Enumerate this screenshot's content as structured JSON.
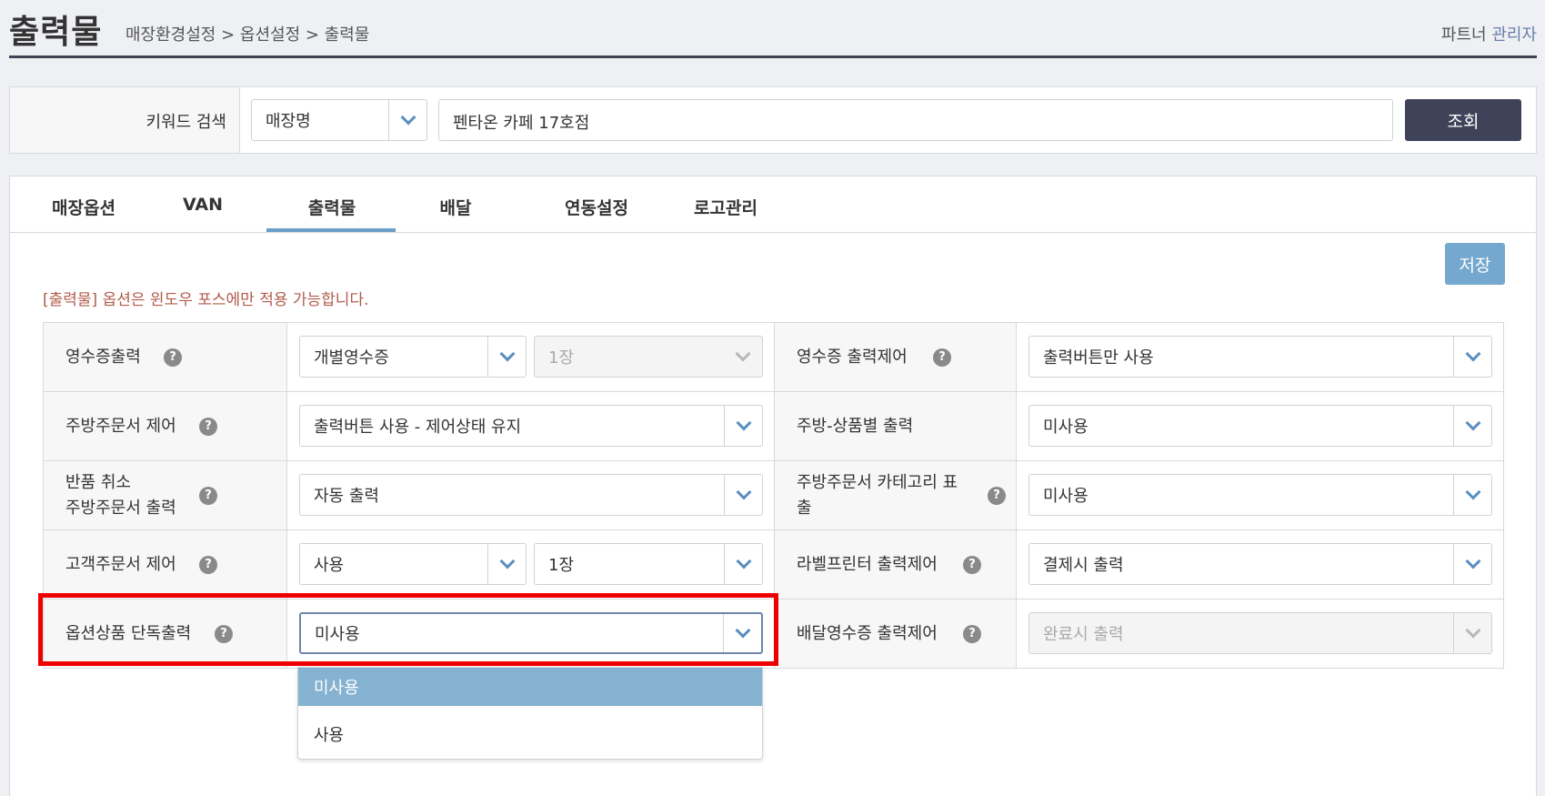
{
  "header": {
    "title": "출력물",
    "breadcrumb": "매장환경설정 > 옵션설정 > 출력물",
    "role_prefix": "파트너",
    "role_accent": "관리자"
  },
  "search": {
    "label": "키워드 검색",
    "field_select": "매장명",
    "keyword_value": "펜타온 카페 17호점",
    "button": "조회"
  },
  "tabs": [
    {
      "label": "매장옵션"
    },
    {
      "label": "VAN"
    },
    {
      "label": "출력물",
      "active": true
    },
    {
      "label": "배달"
    },
    {
      "label": "연동설정"
    },
    {
      "label": "로고관리"
    }
  ],
  "save_button": "저장",
  "notice": "[출력물] 옵션은 윈도우 포스에만 적용 가능합니다.",
  "help_glyph": "?",
  "options": {
    "r0": {
      "left_label": "영수증출력",
      "left_select_1": "개별영수증",
      "left_select_2": "1장",
      "left_select_2_disabled": true,
      "right_label": "영수증 출력제어",
      "right_select": "출력버튼만 사용"
    },
    "r1": {
      "left_label": "주방주문서 제어",
      "left_select": "출력버튼 사용 - 제어상태 유지",
      "right_label": "주방-상품별 출력",
      "right_select": "미사용"
    },
    "r2": {
      "left_label_line1": "반품 취소",
      "left_label_line2": "주방주문서 출력",
      "left_select": "자동 출력",
      "right_label_line1": "주방주문서 카테고리 표",
      "right_label_line2": "출",
      "right_select": "미사용"
    },
    "r3": {
      "left_label": "고객주문서 제어",
      "left_select_1": "사용",
      "left_select_2": "1장",
      "right_label": "라벨프린터 출력제어",
      "right_select": "결제시 출력"
    },
    "r4": {
      "left_label": "옵션상품 단독출력",
      "left_select": "미사용",
      "right_label": "배달영수증 출력제어",
      "right_select": "완료시 출력",
      "right_select_disabled": true
    }
  },
  "dropdown": {
    "options": [
      "미사용",
      "사용"
    ],
    "selected": "미사용"
  },
  "colors": {
    "dark_button": "#3f4359",
    "save_button": "#74a8cf",
    "tab_underline": "#6aa0c8",
    "notice_text": "#b25b4b",
    "highlight": "#ee0000",
    "dropdown_selected": "#85b2d0"
  }
}
